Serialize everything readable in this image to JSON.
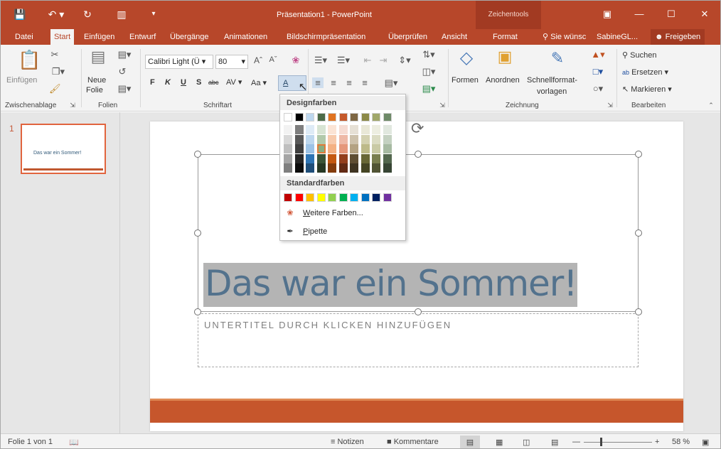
{
  "window": {
    "title": "Präsentation1 - PowerPoint",
    "context_label": "Zeichentools"
  },
  "tabs": [
    "Datei",
    "Start",
    "Einfügen",
    "Entwurf",
    "Übergänge",
    "Animationen",
    "Bildschirmpräsentation",
    "Überprüfen",
    "Ansicht",
    "Format"
  ],
  "active_tab": "Start",
  "tell_me": "Sie wünsc",
  "user": "SabineGL...",
  "share": "Freigeben",
  "ribbon": {
    "clipboard": {
      "paste": "Einfügen",
      "label": "Zwischenablage"
    },
    "slides": {
      "new_slide_1": "Neue",
      "new_slide_2": "Folie",
      "label": "Folien"
    },
    "font": {
      "font_name": "Calibri Light (Ü",
      "font_size": "80",
      "bold": "F",
      "italic": "K",
      "underline": "U",
      "strike": "S",
      "abc": "abc",
      "spacing": "AV",
      "case": "Aa",
      "color_a": "A",
      "label": "Schriftart"
    },
    "drawing": {
      "shapes": "Formen",
      "arrange": "Anordnen",
      "quick_1": "Schnellformat-",
      "quick_2": "vorlagen",
      "label": "Zeichnung"
    },
    "editing": {
      "find": "Suchen",
      "replace": "Ersetzen",
      "select": "Markieren",
      "label": "Bearbeiten"
    }
  },
  "thumbnail": {
    "number": "1",
    "text": "Das war ein Sommer!"
  },
  "slide": {
    "title": "Das war ein Sommer!",
    "subtitle": "UNTERTITEL DURCH KLICKEN HINZUFÜGEN"
  },
  "color_picker": {
    "theme_heading": "Designfarben",
    "standard_heading": "Standardfarben",
    "theme_top": [
      "#ffffff",
      "#000000",
      "#bdd7ee",
      "#4c6b48",
      "#e07320",
      "#c55a2c",
      "#7f6844",
      "#8c8a48",
      "#a1a86a",
      "#6e8a68"
    ],
    "theme_cols": [
      [
        "#f2f2f2",
        "#d8d8d8",
        "#bfbfbf",
        "#a5a5a5",
        "#7f7f7f"
      ],
      [
        "#7f7f7f",
        "#595959",
        "#3f3f3f",
        "#262626",
        "#0c0c0c"
      ],
      [
        "#deebf6",
        "#bdd7ee",
        "#9dc3e6",
        "#2e75b5",
        "#1f4e79"
      ],
      [
        "#d7e4d3",
        "#b1c9aa",
        "#8aad80",
        "#3b5437",
        "#273824"
      ],
      [
        "#fbe4d5",
        "#f7caac",
        "#f4b183",
        "#c45911",
        "#843c0c"
      ],
      [
        "#f6dcd3",
        "#eeb9a7",
        "#e5977b",
        "#933f1d",
        "#622a14"
      ],
      [
        "#e6e0d5",
        "#cdc1ab",
        "#b4a282",
        "#5f4e33",
        "#3f3422"
      ],
      [
        "#e9e8d7",
        "#d3d1b0",
        "#bdba89",
        "#686736",
        "#454524"
      ],
      [
        "#edeee1",
        "#dbdcc3",
        "#c9caa5",
        "#797e4f",
        "#515434"
      ],
      [
        "#e1e8df",
        "#c4d1c1",
        "#a7baa2",
        "#53674e",
        "#374534"
      ]
    ],
    "selected_swatch": "column 4, row 3",
    "standard": [
      "#c00000",
      "#ff0000",
      "#ffc000",
      "#ffff00",
      "#92d050",
      "#00b050",
      "#00b0f0",
      "#0070c0",
      "#002060",
      "#7030a0"
    ],
    "more_colors_prefix": "W",
    "more_colors_rest": "eitere Farben...",
    "eyedropper_prefix": "P",
    "eyedropper_rest": "ipette"
  },
  "status": {
    "slide_info": "Folie 1 von 1",
    "notes": "Notizen",
    "comments": "Kommentare",
    "zoom": "58 %"
  }
}
